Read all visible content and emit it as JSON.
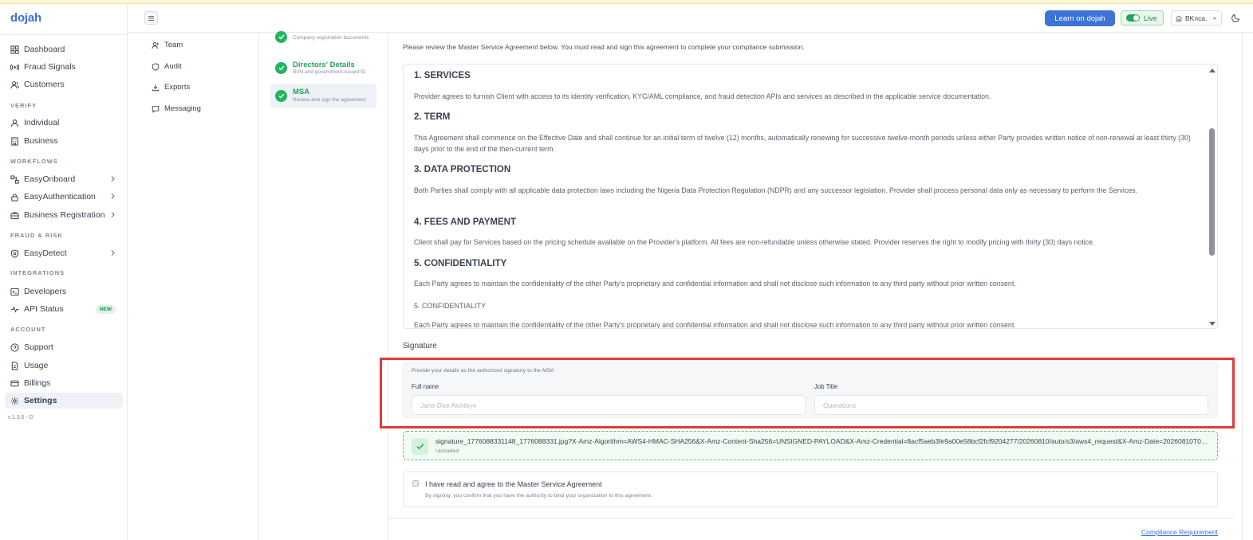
{
  "app": {
    "logo": "dojah",
    "version": "v.1.3.6 - D"
  },
  "sidebar": {
    "top_items": [
      {
        "label": "Dashboard",
        "icon": "grid-icon"
      },
      {
        "label": "Fraud Signals",
        "icon": "signal-icon"
      },
      {
        "label": "Customers",
        "icon": "users-icon"
      }
    ],
    "sections": {
      "verify": "VERIFY",
      "workflows": "WORKFLOWS",
      "fraud_risk": "FRAUD & RISK",
      "integrations": "INTEGRATIONS",
      "account": "ACCOUNT"
    },
    "verify_items": [
      {
        "label": "Individual",
        "icon": "user-icon"
      },
      {
        "label": "Business",
        "icon": "building-icon"
      }
    ],
    "workflow_items": [
      {
        "label": "EasyOnboard",
        "icon": "flow-icon"
      },
      {
        "label": "EasyAuthentication",
        "icon": "lock-icon"
      },
      {
        "label": "Business Registration",
        "icon": "briefcase-icon"
      }
    ],
    "fraud_items": [
      {
        "label": "EasyDetect",
        "icon": "shield-icon"
      }
    ],
    "integration_items": [
      {
        "label": "Developers",
        "icon": "terminal-icon"
      },
      {
        "label": "API Status",
        "icon": "pulse-icon",
        "badge": "NEW"
      }
    ],
    "account_items": [
      {
        "label": "Support",
        "icon": "help-icon"
      },
      {
        "label": "Usage",
        "icon": "document-icon"
      },
      {
        "label": "Billings",
        "icon": "card-icon"
      },
      {
        "label": "Settings",
        "icon": "gear-icon",
        "active": true
      }
    ]
  },
  "header": {
    "learn_button": "Learn on dojah",
    "live_label": "Live",
    "org_name": "BKnca."
  },
  "settings_nav": [
    {
      "label": "Team",
      "icon": "users-icon"
    },
    {
      "label": "Audit",
      "icon": "shield-icon"
    },
    {
      "label": "Exports",
      "icon": "download-icon"
    },
    {
      "label": "Messaging",
      "icon": "message-icon"
    }
  ],
  "steps": [
    {
      "title": "",
      "desc": "Company registration documents"
    },
    {
      "title": "Directors' Details",
      "desc": "BVN and government-issued ID"
    },
    {
      "title": "MSA",
      "desc": "Review and sign the agreement",
      "active": true
    }
  ],
  "msa": {
    "intro": "Please review the Master Service Agreement below. You must read and sign this agreement to complete your compliance submission.",
    "sections": [
      {
        "title": "1. SERVICES",
        "body": "Provider agrees to furnish Client with access to its identity verification, KYC/AML compliance, and fraud detection APIs and services as described in the applicable service documentation."
      },
      {
        "title": "2. TERM",
        "body": "This Agreement shall commence on the Effective Date and shall continue for an initial term of twelve (12) months, automatically renewing for successive twelve-month periods unless either Party provides written notice of non-renewal at least thirty (30) days prior to the end of the then-current term."
      },
      {
        "title": "3. DATA PROTECTION",
        "body": "Both Parties shall comply with all applicable data protection laws including the Nigeria Data Protection Regulation (NDPR) and any successor legislation. Provider shall process personal data only as necessary to perform the Services."
      },
      {
        "title": "4. FEES AND PAYMENT",
        "body": "Client shall pay for Services based on the pricing schedule available on the Provider's platform. All fees are non-refundable unless otherwise stated. Provider reserves the right to modify pricing with thirty (30) days notice."
      },
      {
        "title": "5. CONFIDENTIALITY",
        "body": "Each Party agrees to maintain the confidentiality of the other Party's proprietary and confidential information and shall not disclose such information to any third party without prior written consent."
      }
    ],
    "repeat_title": "5. CONFIDENTIALITY",
    "repeat_body": "Each Party agrees to maintain the confidentiality of the other Party's proprietary and confidential information and shall not disclose such information to any third party without prior written consent."
  },
  "signature": {
    "label": "Signature",
    "hint": "Provide your details as the authorized signatory to the MSA",
    "full_name_label": "Full name",
    "full_name_placeholder": "Jane Doe Akinleye",
    "full_name_value": "",
    "job_title_label": "Job Title",
    "job_title_placeholder": "Operations",
    "job_title_value": ""
  },
  "upload": {
    "filename": "signature_1776088331148_1776088331.jpg?X-Amz-Algorithm=AWS4-HMAC-SHA256&X-Amz-Content-Sha256=UNSIGNED-PAYLOAD&X-Amz-Credential=8acf5aeb3fe9a00e58bcf2fcf9204277/20260810/auto/s3/aws4_request&X-Amz-Date=20260810T000000Z",
    "status": "Uploaded"
  },
  "agreement": {
    "checkbox_label": "I have read and agree to the Master Service Agreement",
    "sub": "By signing, you confirm that you have the authority to bind your organization to this agreement.",
    "checked": false
  },
  "footer": {
    "link": "Compliance Requirement"
  },
  "colors": {
    "brand": "#3b6fd8",
    "success": "#22b463",
    "highlight": "#e03a3a"
  }
}
